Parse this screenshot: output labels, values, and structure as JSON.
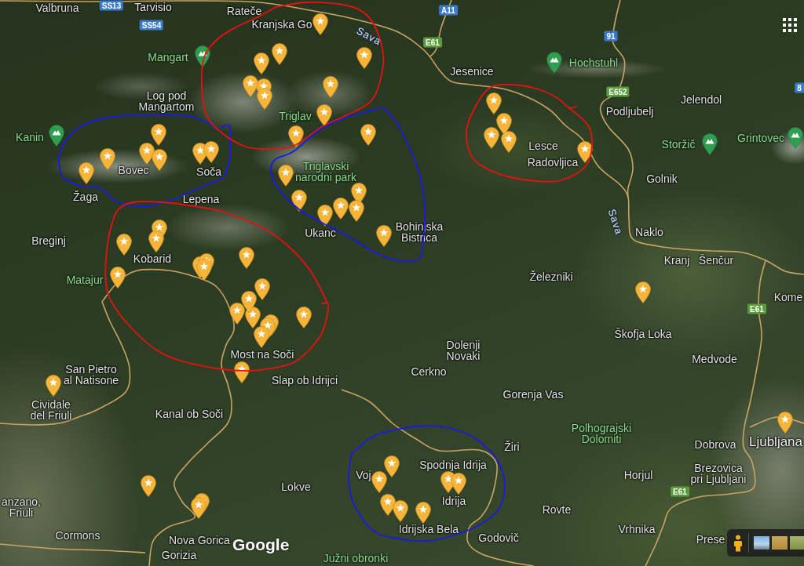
{
  "map": {
    "labels": [
      {
        "text": "Valbruna",
        "kind": "town"
      },
      {
        "text": "Tarvisio",
        "kind": "town"
      },
      {
        "text": "Rateče",
        "kind": "town"
      },
      {
        "text": "Kranjska Go",
        "kind": "town"
      },
      {
        "text": "Sava",
        "kind": "river"
      },
      {
        "text": "Mangart",
        "kind": "peak"
      },
      {
        "text": "Jesenice",
        "kind": "town"
      },
      {
        "text": "Hochstuhl",
        "kind": "peak"
      },
      {
        "text": "Log pod Mangartom",
        "kind": "town"
      },
      {
        "text": "Jelendol",
        "kind": "town"
      },
      {
        "text": "Triglav",
        "kind": "nature"
      },
      {
        "text": "Podljubelj",
        "kind": "town"
      },
      {
        "text": "Kanin",
        "kind": "peak"
      },
      {
        "text": "Lesce",
        "kind": "town"
      },
      {
        "text": "Storžič",
        "kind": "peak"
      },
      {
        "text": "Grintovec",
        "kind": "peak"
      },
      {
        "text": "Bovec",
        "kind": "town"
      },
      {
        "text": "Soča",
        "kind": "town"
      },
      {
        "text": "Triglavski narodni park",
        "kind": "nature"
      },
      {
        "text": "Radovljica",
        "kind": "town"
      },
      {
        "text": "Golnik",
        "kind": "town"
      },
      {
        "text": "Žaga",
        "kind": "town"
      },
      {
        "text": "Lepena",
        "kind": "town"
      },
      {
        "text": "Breginj",
        "kind": "town"
      },
      {
        "text": "Ukanc",
        "kind": "town"
      },
      {
        "text": "Bohinjska Bistrica",
        "kind": "town"
      },
      {
        "text": "Sava",
        "kind": "river"
      },
      {
        "text": "Naklo",
        "kind": "town"
      },
      {
        "text": "Kobarid",
        "kind": "town"
      },
      {
        "text": "Kranj",
        "kind": "town"
      },
      {
        "text": "Šenčur",
        "kind": "town"
      },
      {
        "text": "Matajur",
        "kind": "nature"
      },
      {
        "text": "Železniki",
        "kind": "town"
      },
      {
        "text": "Kome",
        "kind": "town"
      },
      {
        "text": "Škofja Loka",
        "kind": "town"
      },
      {
        "text": "Most na Soči",
        "kind": "town"
      },
      {
        "text": "Dolenji Novaki",
        "kind": "town"
      },
      {
        "text": "Medvode",
        "kind": "town"
      },
      {
        "text": "San Pietro al Natisone",
        "kind": "town"
      },
      {
        "text": "Slap ob Idrijci",
        "kind": "town"
      },
      {
        "text": "Cerkno",
        "kind": "town"
      },
      {
        "text": "Gorenja Vas",
        "kind": "town"
      },
      {
        "text": "Cividale del Friuli",
        "kind": "town"
      },
      {
        "text": "Kanal ob Soči",
        "kind": "town"
      },
      {
        "text": "Žiri",
        "kind": "town"
      },
      {
        "text": "Polhograjski Dolomiti",
        "kind": "nature"
      },
      {
        "text": "Dobrova",
        "kind": "town"
      },
      {
        "text": "Ljubljana",
        "kind": "city"
      },
      {
        "text": "Voj",
        "kind": "town"
      },
      {
        "text": "Spodnja Idrija",
        "kind": "town"
      },
      {
        "text": "Horjul",
        "kind": "town"
      },
      {
        "text": "Lokve",
        "kind": "town"
      },
      {
        "text": "Brezovica pri Ljubljani",
        "kind": "town"
      },
      {
        "text": "anzano, Friuli",
        "kind": "town"
      },
      {
        "text": "Idrija",
        "kind": "town"
      },
      {
        "text": "Rovte",
        "kind": "town"
      },
      {
        "text": "Cormons",
        "kind": "town"
      },
      {
        "text": "Nova Gorica",
        "kind": "town"
      },
      {
        "text": "Idrijska Bela",
        "kind": "town"
      },
      {
        "text": "Godovič",
        "kind": "town"
      },
      {
        "text": "Vrhnika",
        "kind": "town"
      },
      {
        "text": "Prese",
        "kind": "town"
      },
      {
        "text": "Gorizia",
        "kind": "town"
      },
      {
        "text": "Južni obronki",
        "kind": "nature"
      }
    ],
    "road_shields": [
      {
        "text": "SS13",
        "color": "#3b79c9"
      },
      {
        "text": "A11",
        "color": "#3b79c9"
      },
      {
        "text": "SS54",
        "color": "#3b79c9"
      },
      {
        "text": "E61",
        "color": "#5a9e3c"
      },
      {
        "text": "91",
        "color": "#3b79c9"
      },
      {
        "text": "E652",
        "color": "#5a9e3c"
      },
      {
        "text": "8",
        "color": "#3b79c9"
      },
      {
        "text": "E61",
        "color": "#5a9e3c"
      },
      {
        "text": "E61",
        "color": "#5a9e3c"
      }
    ],
    "circles": [
      {
        "color": "#1a1ae6"
      },
      {
        "color": "#e81010"
      },
      {
        "color": "#1a1ae6"
      },
      {
        "color": "#e81010"
      },
      {
        "color": "#e81010"
      },
      {
        "color": "#1a1ae6"
      }
    ],
    "logo": "Google"
  }
}
